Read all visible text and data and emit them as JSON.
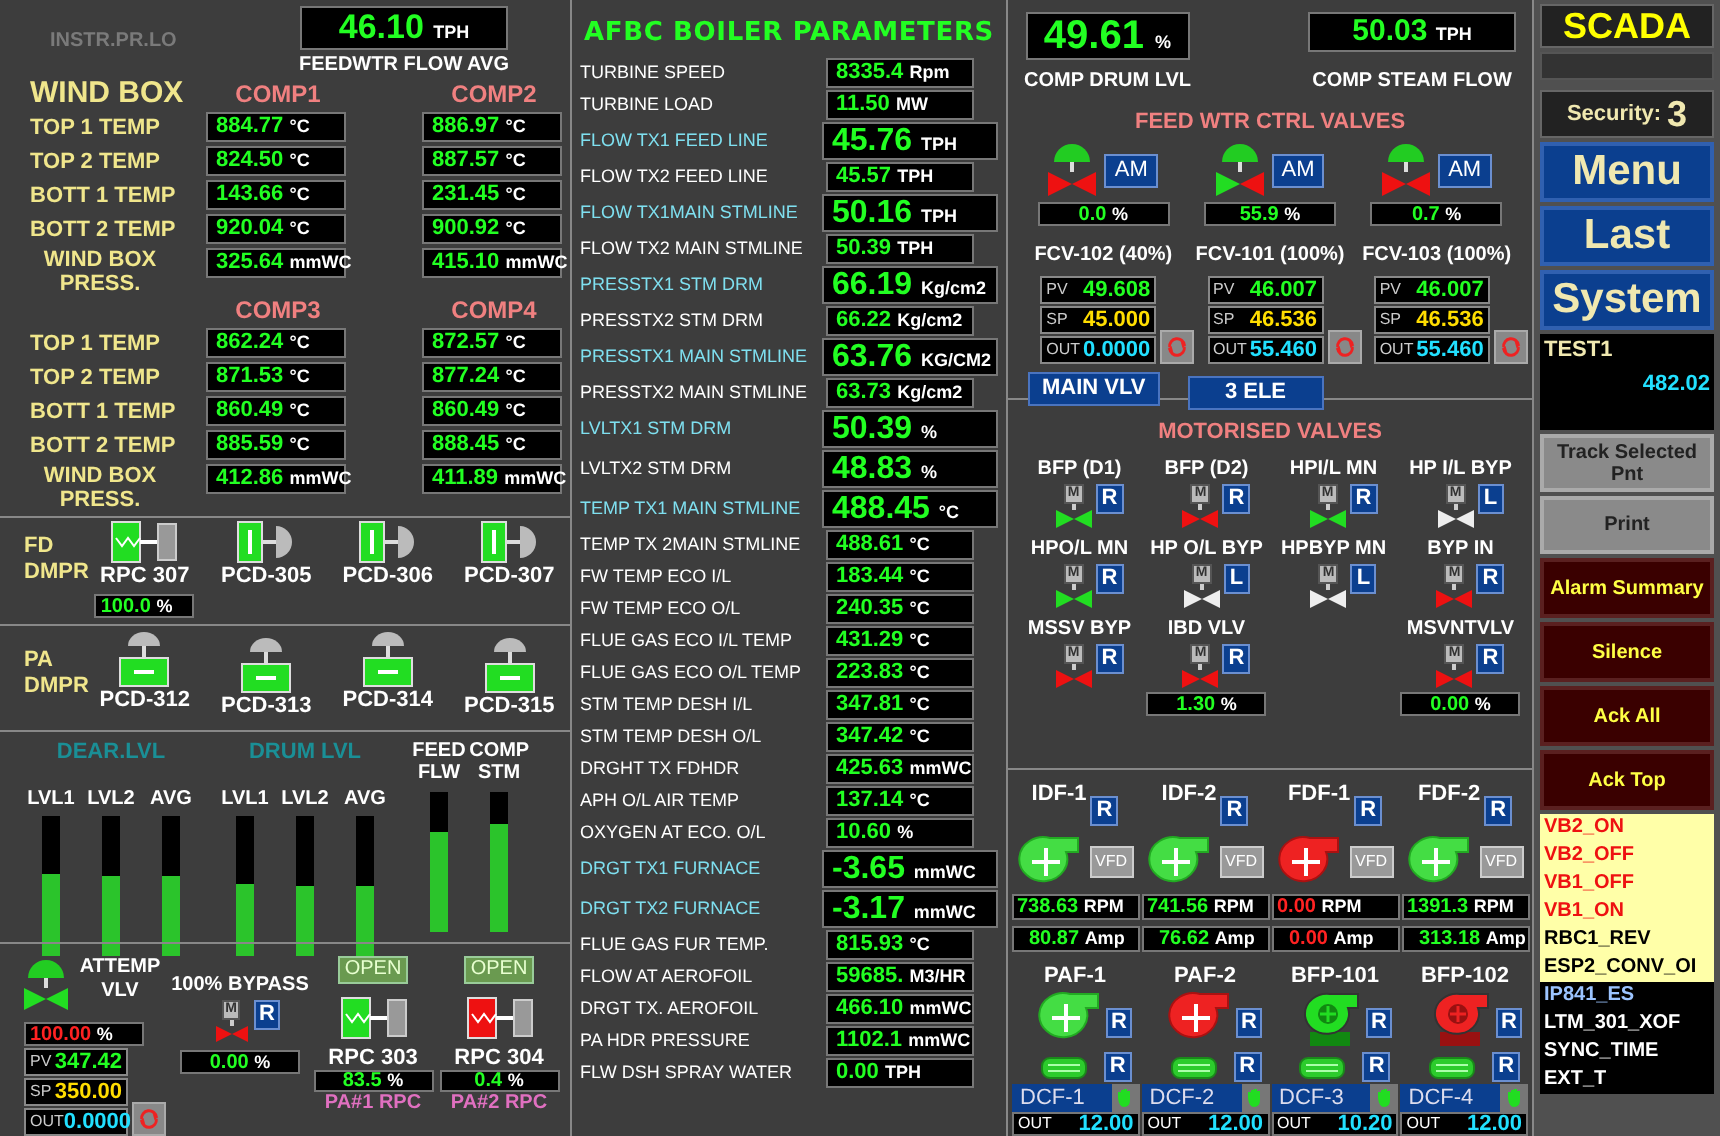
{
  "left": {
    "instr_label": "INSTR.PR.LO",
    "feedwater_flow": {
      "value": "46.10",
      "unit": "TPH",
      "label": "FEEDWTR FLOW AVG"
    },
    "wind_box": {
      "title": "WIND BOX",
      "groups": [
        {
          "comps": [
            "COMP1",
            "COMP2"
          ],
          "rows": [
            {
              "label": "TOP 1 TEMP",
              "readings": [
                {
                  "value": "884.77",
                  "unit": "°C"
                },
                {
                  "value": "886.97",
                  "unit": "°C"
                }
              ]
            },
            {
              "label": "TOP 2 TEMP",
              "readings": [
                {
                  "value": "824.50",
                  "unit": "°C"
                },
                {
                  "value": "887.57",
                  "unit": "°C"
                }
              ]
            },
            {
              "label": "BOTT 1 TEMP",
              "readings": [
                {
                  "value": "143.66",
                  "unit": "°C"
                },
                {
                  "value": "231.45",
                  "unit": "°C"
                }
              ]
            },
            {
              "label": "BOTT 2 TEMP",
              "readings": [
                {
                  "value": "920.04",
                  "unit": "°C"
                },
                {
                  "value": "900.92",
                  "unit": "°C"
                }
              ]
            },
            {
              "label": "WIND BOX PRESS.",
              "readings": [
                {
                  "value": "325.64",
                  "unit": "mmWC"
                },
                {
                  "value": "415.10",
                  "unit": "mmWC"
                }
              ]
            }
          ]
        },
        {
          "comps": [
            "COMP3",
            "COMP4"
          ],
          "rows": [
            {
              "label": "TOP 1 TEMP",
              "readings": [
                {
                  "value": "862.24",
                  "unit": "°C"
                },
                {
                  "value": "872.57",
                  "unit": "°C"
                }
              ]
            },
            {
              "label": "TOP 2 TEMP",
              "readings": [
                {
                  "value": "871.53",
                  "unit": "°C"
                },
                {
                  "value": "877.24",
                  "unit": "°C"
                }
              ]
            },
            {
              "label": "BOTT 1 TEMP",
              "readings": [
                {
                  "value": "860.49",
                  "unit": "°C"
                },
                {
                  "value": "860.49",
                  "unit": "°C"
                }
              ]
            },
            {
              "label": "BOTT 2 TEMP",
              "readings": [
                {
                  "value": "885.59",
                  "unit": "°C"
                },
                {
                  "value": "888.45",
                  "unit": "°C"
                }
              ]
            },
            {
              "label": "WIND BOX PRESS.",
              "readings": [
                {
                  "value": "412.86",
                  "unit": "mmWC"
                },
                {
                  "value": "411.89",
                  "unit": "mmWC"
                }
              ]
            }
          ]
        }
      ]
    },
    "fd_dampers": {
      "label": "FD DMPR",
      "items": [
        {
          "name": "RPC 307",
          "kind": "rpc",
          "open": true,
          "reading": {
            "value": "100.0",
            "unit": "%"
          }
        },
        {
          "name": "PCD-305",
          "kind": "pcd",
          "open": true
        },
        {
          "name": "PCD-306",
          "kind": "pcd",
          "open": true
        },
        {
          "name": "PCD-307",
          "kind": "pcd",
          "open": true
        }
      ]
    },
    "pa_dampers": {
      "label": "PA DMPR",
      "items": [
        {
          "name": "PCD-312",
          "open": true
        },
        {
          "name": "PCD-313",
          "open": true
        },
        {
          "name": "PCD-314",
          "open": true
        },
        {
          "name": "PCD-315",
          "open": true
        }
      ]
    },
    "levels": [
      {
        "title": "DEAR.LVL",
        "bars": [
          {
            "label": "LVL1",
            "level": 0.58
          },
          {
            "label": "LVL2",
            "level": 0.57
          },
          {
            "label": "AVG",
            "level": 0.57
          }
        ]
      },
      {
        "title": "DRUM LVL",
        "bars": [
          {
            "label": "LVL1",
            "level": 0.51
          },
          {
            "label": "LVL2",
            "level": 0.5
          },
          {
            "label": "AVG",
            "level": 0.5
          }
        ]
      },
      {
        "bars": [
          {
            "label": "FEED FLW",
            "level": 0.72
          },
          {
            "label": "COMP STM",
            "level": 0.77
          }
        ]
      }
    ],
    "attemp": {
      "label": "ATTEMP VLV",
      "open": true,
      "output": {
        "value": "100.00",
        "unit": "%",
        "alarm": true
      },
      "values": [
        {
          "kind": "pv",
          "label": "PV",
          "value": "347.42"
        },
        {
          "kind": "sp",
          "label": "SP",
          "value": "350.00"
        },
        {
          "kind": "out",
          "label": "OUT",
          "value": "0.0000"
        }
      ]
    },
    "bypass": {
      "label": "100% BYPASS",
      "actuator": "M",
      "mode": "R",
      "open": false,
      "reading": {
        "value": "0.00",
        "unit": "%"
      }
    },
    "rpcs": [
      {
        "status": "OPEN",
        "open": true,
        "name": "RPC 303",
        "reading": {
          "value": "83.5",
          "unit": "%"
        },
        "caption": "PA#1 RPC"
      },
      {
        "status": "OPEN",
        "open": false,
        "name": "RPC 304",
        "reading": {
          "value": "0.4",
          "unit": "%"
        },
        "caption": "PA#2 RPC"
      }
    ]
  },
  "parameters": {
    "title": "AFBC BOILER PARAMETERS",
    "rows": [
      {
        "label": "TURBINE SPEED",
        "value": "8335.4",
        "unit": "Rpm",
        "highlight": false,
        "large": false
      },
      {
        "label": "TURBINE LOAD",
        "value": "11.50",
        "unit": "MW",
        "highlight": false,
        "large": false
      },
      {
        "label": "FLOW TX1 FEED LINE",
        "value": "45.76",
        "unit": "TPH",
        "highlight": true,
        "large": true
      },
      {
        "label": "FLOW TX2 FEED LINE",
        "value": "45.57",
        "unit": "TPH",
        "highlight": false,
        "large": false
      },
      {
        "label": "FLOW TX1MAIN STMLINE",
        "value": "50.16",
        "unit": "TPH",
        "highlight": true,
        "large": true
      },
      {
        "label": "FLOW TX2 MAIN STMLINE",
        "value": "50.39",
        "unit": "TPH",
        "highlight": false,
        "large": false
      },
      {
        "label": "PRESSTX1 STM DRM",
        "value": "66.19",
        "unit": "Kg/cm2",
        "highlight": true,
        "large": true
      },
      {
        "label": "PRESSTX2 STM DRM",
        "value": "66.22",
        "unit": "Kg/cm2",
        "highlight": false,
        "large": false
      },
      {
        "label": "PRESSTX1 MAIN STMLINE",
        "value": "63.76",
        "unit": "KG/CM2",
        "highlight": true,
        "large": true
      },
      {
        "label": "PRESSTX2 MAIN STMLINE",
        "value": "63.73",
        "unit": "Kg/cm2",
        "highlight": false,
        "large": false
      },
      {
        "label": "LVLTX1 STM DRM",
        "value": "50.39",
        "unit": "%",
        "highlight": true,
        "large": true
      },
      {
        "label": "LVLTX2 STM DRM",
        "value": "48.83",
        "unit": "%",
        "highlight": false,
        "large": true
      },
      {
        "label": "TEMP TX1 MAIN STMLINE",
        "value": "488.45",
        "unit": "°C",
        "highlight": true,
        "large": true
      },
      {
        "label": "TEMP TX 2MAIN STMLINE",
        "value": "488.61",
        "unit": "°C",
        "highlight": false,
        "large": false
      },
      {
        "label": "FW TEMP ECO I/L",
        "value": "183.44",
        "unit": "°C",
        "highlight": false,
        "large": false
      },
      {
        "label": "FW TEMP ECO O/L",
        "value": "240.35",
        "unit": "°C",
        "highlight": false,
        "large": false
      },
      {
        "label": "FLUE GAS ECO I/L TEMP",
        "value": "431.29",
        "unit": "°C",
        "highlight": false,
        "large": false
      },
      {
        "label": "FLUE GAS ECO O/L TEMP",
        "value": "223.83",
        "unit": "°C",
        "highlight": false,
        "large": false
      },
      {
        "label": "STM TEMP DESH I/L",
        "value": "347.81",
        "unit": "°C",
        "highlight": false,
        "large": false
      },
      {
        "label": "STM TEMP DESH O/L",
        "value": "347.42",
        "unit": "°C",
        "highlight": false,
        "large": false
      },
      {
        "label": "DRGHT TX FDHDR",
        "value": "425.63",
        "unit": "mmWC",
        "highlight": false,
        "large": false
      },
      {
        "label": "APH O/L AIR TEMP",
        "value": "137.14",
        "unit": "°C",
        "highlight": false,
        "large": false
      },
      {
        "label": "OXYGEN AT ECO. O/L",
        "value": "10.60",
        "unit": "%",
        "highlight": false,
        "large": false
      },
      {
        "label": "DRGT TX1 FURNACE",
        "value": "-3.65",
        "unit": "mmWC",
        "highlight": true,
        "large": true
      },
      {
        "label": "DRGT TX2 FURNACE",
        "value": "-3.17",
        "unit": "mmWC",
        "highlight": true,
        "large": true
      },
      {
        "label": "FLUE GAS FUR TEMP.",
        "value": "815.93",
        "unit": "°C",
        "highlight": false,
        "large": false
      },
      {
        "label": "FLOW AT AEROFOIL",
        "value": "59685.",
        "unit": "M3/HR",
        "highlight": false,
        "large": false
      },
      {
        "label": "DRGT TX.  AEROFOIL",
        "value": "466.10",
        "unit": "mmWC",
        "highlight": false,
        "large": false
      },
      {
        "label": "PA HDR PRESSURE",
        "value": "1102.1",
        "unit": "mmWC",
        "highlight": false,
        "large": false
      },
      {
        "label": "FLW DSH SPRAY WATER",
        "value": "0.00",
        "unit": "TPH",
        "highlight": false,
        "large": false
      }
    ]
  },
  "feedwater": {
    "drum_level": {
      "value": "49.61",
      "unit": "%",
      "label": "COMP DRUM LVL"
    },
    "steam_flow": {
      "value": "50.03",
      "unit": "TPH",
      "label": "COMP STEAM FLOW"
    },
    "title": "FEED WTR CTRL VALVES",
    "valves": [
      {
        "name": "FCV-102 (40%)",
        "open": false,
        "mode": "AM",
        "reading": {
          "value": "0.0",
          "unit": "%"
        },
        "values": [
          {
            "kind": "pv",
            "label": "PV",
            "value": "49.608"
          },
          {
            "kind": "sp",
            "label": "SP",
            "value": "45.000"
          },
          {
            "kind": "out",
            "label": "OUT",
            "value": "0.0000"
          }
        ]
      },
      {
        "name": "FCV-101 (100%)",
        "open": true,
        "mode": "AM",
        "reading": {
          "value": "55.9",
          "unit": "%"
        },
        "values": [
          {
            "kind": "pv",
            "label": "PV",
            "value": "46.007"
          },
          {
            "kind": "sp",
            "label": "SP",
            "value": "46.536"
          },
          {
            "kind": "out",
            "label": "OUT",
            "value": "55.460"
          }
        ]
      },
      {
        "name": "FCV-103 (100%)",
        "open": false,
        "mode": "AM",
        "reading": {
          "value": "0.7",
          "unit": "%"
        },
        "values": [
          {
            "kind": "pv",
            "label": "PV",
            "value": "46.007"
          },
          {
            "kind": "sp",
            "label": "SP",
            "value": "46.536"
          },
          {
            "kind": "out",
            "label": "OUT",
            "value": "55.460"
          }
        ]
      }
    ],
    "buttons": [
      "MAIN VLV",
      "3 ELE"
    ]
  },
  "motorised_valves": {
    "title": "MOTORISED VALVES",
    "rows": [
      [
        {
          "name": "BFP (D1)",
          "actuator": "M",
          "mode": "R",
          "color": "#22dd22"
        },
        {
          "name": "BFP (D2)",
          "actuator": "M",
          "mode": "R",
          "color": "#ee1111"
        },
        {
          "name": "HPI/L MN",
          "actuator": "M",
          "mode": "R",
          "color": "#22dd22"
        },
        {
          "name": "HP I/L BYP",
          "actuator": "M",
          "mode": "L",
          "color": "#eeeeee"
        }
      ],
      [
        {
          "name": "HPO/L MN",
          "actuator": "M",
          "mode": "R",
          "color": "#22dd22"
        },
        {
          "name": "HP O/L BYP",
          "actuator": "M",
          "mode": "L",
          "color": "#eeeeee"
        },
        {
          "name": "HPBYP MN",
          "actuator": "M",
          "mode": "L",
          "color": "#eeeeee"
        },
        {
          "name": "BYP IN",
          "actuator": "M",
          "mode": "R",
          "color": "#ee1111"
        }
      ],
      [
        {
          "name": "MSSV BYP",
          "actuator": "M",
          "mode": "R",
          "color": "#ee1111"
        },
        {
          "name": "IBD VLV",
          "actuator": "M",
          "mode": "R",
          "color": "#ee1111",
          "reading": {
            "value": "1.30",
            "unit": "%"
          }
        },
        "",
        {
          "name": "MSVNTVLV",
          "actuator": "M",
          "mode": "R",
          "color": "#ee1111",
          "reading": {
            "value": "0.00",
            "unit": "%"
          }
        }
      ]
    ]
  },
  "fans": [
    {
      "name": "IDF-1",
      "mode": "R",
      "running": true,
      "vfd": "VFD",
      "rpm": {
        "value": "738.63",
        "unit": "RPM"
      },
      "amp": {
        "value": "80.87",
        "unit": "Amp"
      }
    },
    {
      "name": "IDF-2",
      "mode": "R",
      "running": true,
      "vfd": "VFD",
      "rpm": {
        "value": "741.56",
        "unit": "RPM"
      },
      "amp": {
        "value": "76.62",
        "unit": "Amp"
      }
    },
    {
      "name": "FDF-1",
      "mode": "R",
      "running": false,
      "vfd": "VFD",
      "rpm": {
        "value": "0.00",
        "unit": "RPM"
      },
      "amp": {
        "value": "0.00",
        "unit": "Amp"
      }
    },
    {
      "name": "FDF-2",
      "mode": "R",
      "running": true,
      "vfd": "VFD",
      "rpm": {
        "value": "1391.3",
        "unit": "RPM"
      },
      "amp": {
        "value": "313.18",
        "unit": "Amp"
      }
    }
  ],
  "drives": [
    {
      "name": "PAF-1",
      "kind": "fan",
      "mode": "R",
      "running": true
    },
    {
      "name": "PAF-2",
      "kind": "fan",
      "mode": "R",
      "running": false
    },
    {
      "name": "BFP-101",
      "kind": "pump",
      "mode": "R",
      "running": true
    },
    {
      "name": "BFP-102",
      "kind": "pump",
      "mode": "R",
      "running": false
    }
  ],
  "dampers": [
    {
      "name": "DCF-1",
      "mode": "R",
      "out_label": "OUT",
      "out": "12.00"
    },
    {
      "name": "DCF-2",
      "mode": "R",
      "out_label": "OUT",
      "out": "12.00"
    },
    {
      "name": "DCF-3",
      "mode": "R",
      "out_label": "OUT",
      "out": "10.20"
    },
    {
      "name": "DCF-4",
      "mode": "R",
      "out_label": "OUT",
      "out": "12.00"
    }
  ],
  "sidebar": {
    "title": "SCADA",
    "security_label": "Security:",
    "security_level": "3",
    "nav": [
      "Menu",
      "Last",
      "System"
    ],
    "point": {
      "tag": "TEST1",
      "value": "482.02"
    },
    "tools": [
      "Track Selected Pnt",
      "Print"
    ],
    "alarm_buttons": [
      "Alarm Summary",
      "Silence",
      "Ack All",
      "Ack Top"
    ],
    "alarms": [
      {
        "text": "VB2_ON",
        "kind": "alarm"
      },
      {
        "text": "VB2_OFF",
        "kind": "alarm"
      },
      {
        "text": "VB1_OFF",
        "kind": "alarm"
      },
      {
        "text": "VB1_ON",
        "kind": "alarm"
      },
      {
        "text": "RBC1_REV",
        "kind": "notice"
      },
      {
        "text": "ESP2_CONV_OI",
        "kind": "notice"
      },
      {
        "text": "IP841_ES",
        "kind": "highlight"
      },
      {
        "text": "LTM_301_XOF",
        "kind": "cleared"
      },
      {
        "text": "SYNC_TIME",
        "kind": "cleared"
      },
      {
        "text": "EXT_T",
        "kind": "cleared"
      }
    ]
  }
}
